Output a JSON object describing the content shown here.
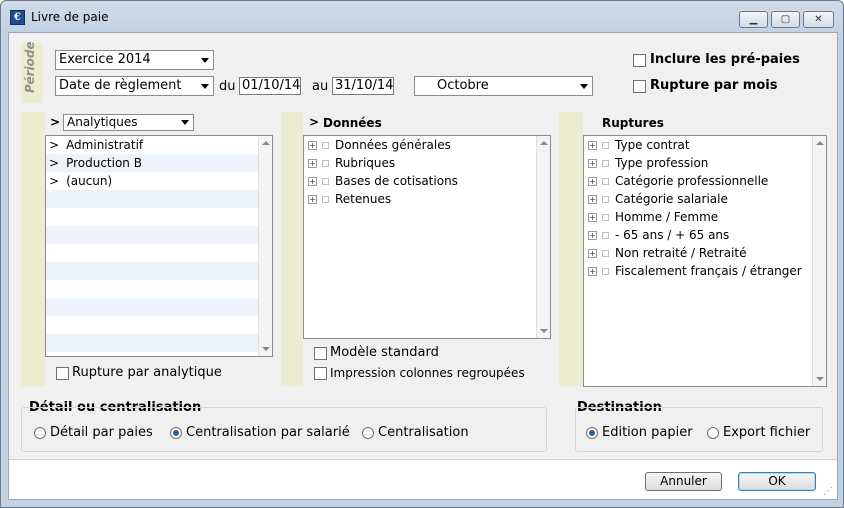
{
  "window": {
    "title": "Livre de paie",
    "icon_letter": "€"
  },
  "period": {
    "section_label": "Période",
    "exercise_select": "Exercice 2014",
    "date_type_select": "Date de règlement",
    "from_label": "du",
    "from_date": "01/10/14",
    "to_label": "au",
    "to_date": "31/10/14",
    "month_select": "Octobre",
    "include_prepaid_label": "Inclure les pré-paies",
    "break_by_month_label": "Rupture par mois"
  },
  "analytics": {
    "arrow": ">",
    "select": "Analytiques",
    "items": [
      {
        "marker": ">",
        "label": "Administratif"
      },
      {
        "marker": ">",
        "label": "Production B"
      },
      {
        "marker": ">",
        "label": "(aucun)"
      }
    ],
    "break_label": "Rupture par analytique"
  },
  "data_panel": {
    "arrow": ">",
    "title": "Données",
    "items": [
      "Données générales",
      "Rubriques",
      "Bases de cotisations",
      "Retenues"
    ],
    "standard_model_label": "Modèle standard",
    "grouped_columns_label": "Impression colonnes regroupées"
  },
  "breaks_panel": {
    "title": "Ruptures",
    "items": [
      "Type contrat",
      "Type profession",
      "Catégorie professionnelle",
      "Catégorie salariale",
      "Homme / Femme",
      "- 65 ans / + 65 ans",
      "Non retraité / Retraité",
      "Fiscalement français / étranger"
    ]
  },
  "detail": {
    "title": "Détail ou centralisation",
    "options": [
      "Détail par paies",
      "Centralisation par salarié",
      "Centralisation"
    ],
    "selected": "Centralisation par salarié"
  },
  "destination": {
    "title": "Destination",
    "options": [
      "Edition papier",
      "Export fichier"
    ],
    "selected": "Edition papier"
  },
  "buttons": {
    "cancel": "Annuler",
    "ok": "OK"
  },
  "icons": [
    "app-icon",
    "minimize-icon",
    "maximize-icon",
    "close-icon",
    "dropdown-arrow-icon",
    "expand-plus-icon",
    "scroll-up-icon",
    "scroll-down-icon",
    "resize-grip-icon"
  ]
}
